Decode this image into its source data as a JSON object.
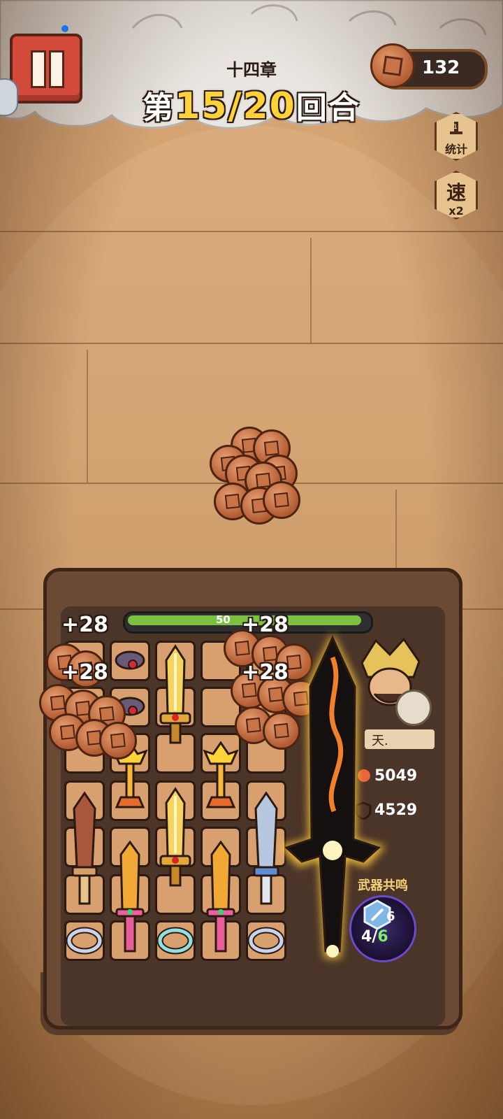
{
  "header": {
    "chapter": "十四章",
    "round_prefix": "第",
    "round_current": "15/20",
    "round_suffix": "回合",
    "coins": "132"
  },
  "side_buttons": {
    "stats_label": "统计",
    "speed_char": "速",
    "speed_mult": "x2"
  },
  "board": {
    "hp_text": "50",
    "hp_fraction": 0.97,
    "gains": [
      "+28",
      "+28",
      "+28",
      "+28"
    ],
    "hero_name": "天.",
    "attack": "5049",
    "defense": "4529",
    "resonance_label": "武器共鸣",
    "resonance_level": "6",
    "resonance_progress_current": "4",
    "resonance_progress_sep": "/",
    "resonance_progress_total": "6"
  },
  "colors": {
    "pause_red": "#d24a3a",
    "round_number_yellow": "#ffd23a",
    "hp_green": "#7ac142",
    "resonance_green": "#7cf06a"
  },
  "icons": {
    "pause": "pause-icon",
    "coin": "copper-coin-icon",
    "stats": "stats-icon",
    "speed": "speed-icon"
  }
}
